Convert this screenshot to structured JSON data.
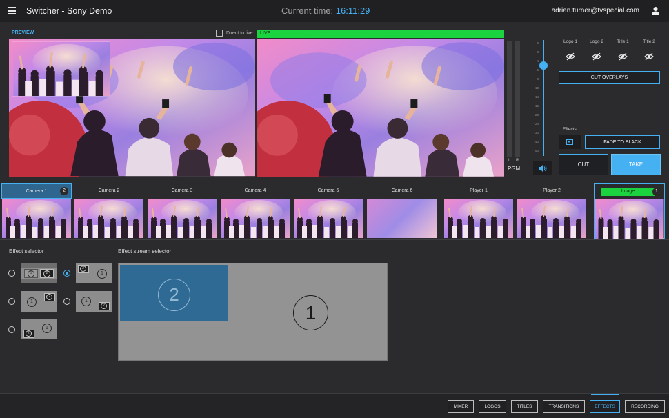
{
  "app": {
    "title": "Switcher - Sony Demo"
  },
  "header": {
    "time_label": "Current time:",
    "time_value": "16:11:29",
    "user_email": "adrian.turner@tvspecial.com"
  },
  "preview": {
    "label": "PREVIEW",
    "direct_to_live_label": "Direct to live",
    "direct_to_live_checked": false
  },
  "live": {
    "label": "LIVE"
  },
  "audio": {
    "l_label": "L",
    "r_label": "R",
    "pgm_label": "PGM",
    "scale": [
      "-6",
      "-8",
      "-4",
      "-6",
      "-8",
      "-10",
      "-14",
      "-16",
      "-20",
      "-24",
      "-30",
      "-40",
      "-50"
    ]
  },
  "overlays": {
    "items": [
      {
        "label": "Logo 1"
      },
      {
        "label": "Logo 2"
      },
      {
        "label": "Title 1"
      },
      {
        "label": "Title 2"
      }
    ],
    "cut_overlays_label": "CUT OVERLAYS"
  },
  "effects_panel": {
    "label": "Effects",
    "fade_to_black_label": "FADE TO BLACK",
    "cut_label": "CUT",
    "take_label": "TAKE"
  },
  "sources": [
    {
      "label": "Camera 1",
      "badge": "2"
    },
    {
      "label": "Camera 2"
    },
    {
      "label": "Camera 3"
    },
    {
      "label": "Camera 4"
    },
    {
      "label": "Camera 5"
    },
    {
      "label": "Camera 6"
    },
    {
      "label": "Player 1"
    },
    {
      "label": "Player 2"
    },
    {
      "label": "Image",
      "badge": "1"
    }
  ],
  "effect_selector": {
    "title": "Effect selector",
    "selected_index": 1
  },
  "effect_stream_selector": {
    "title": "Effect stream selector",
    "pip_number": "2",
    "main_number": "1"
  },
  "layout_numbers": {
    "one": "1",
    "two": "2"
  },
  "tabs": [
    {
      "label": "MIXER"
    },
    {
      "label": "LOGOS"
    },
    {
      "label": "TITLES"
    },
    {
      "label": "TRANSITIONS"
    },
    {
      "label": "EFFECTS"
    },
    {
      "label": "RECORDING"
    }
  ],
  "active_tab": "EFFECTS",
  "colors": {
    "accent": "#45b1f2",
    "live": "#1bd23f",
    "background": "#2b2b2d"
  }
}
